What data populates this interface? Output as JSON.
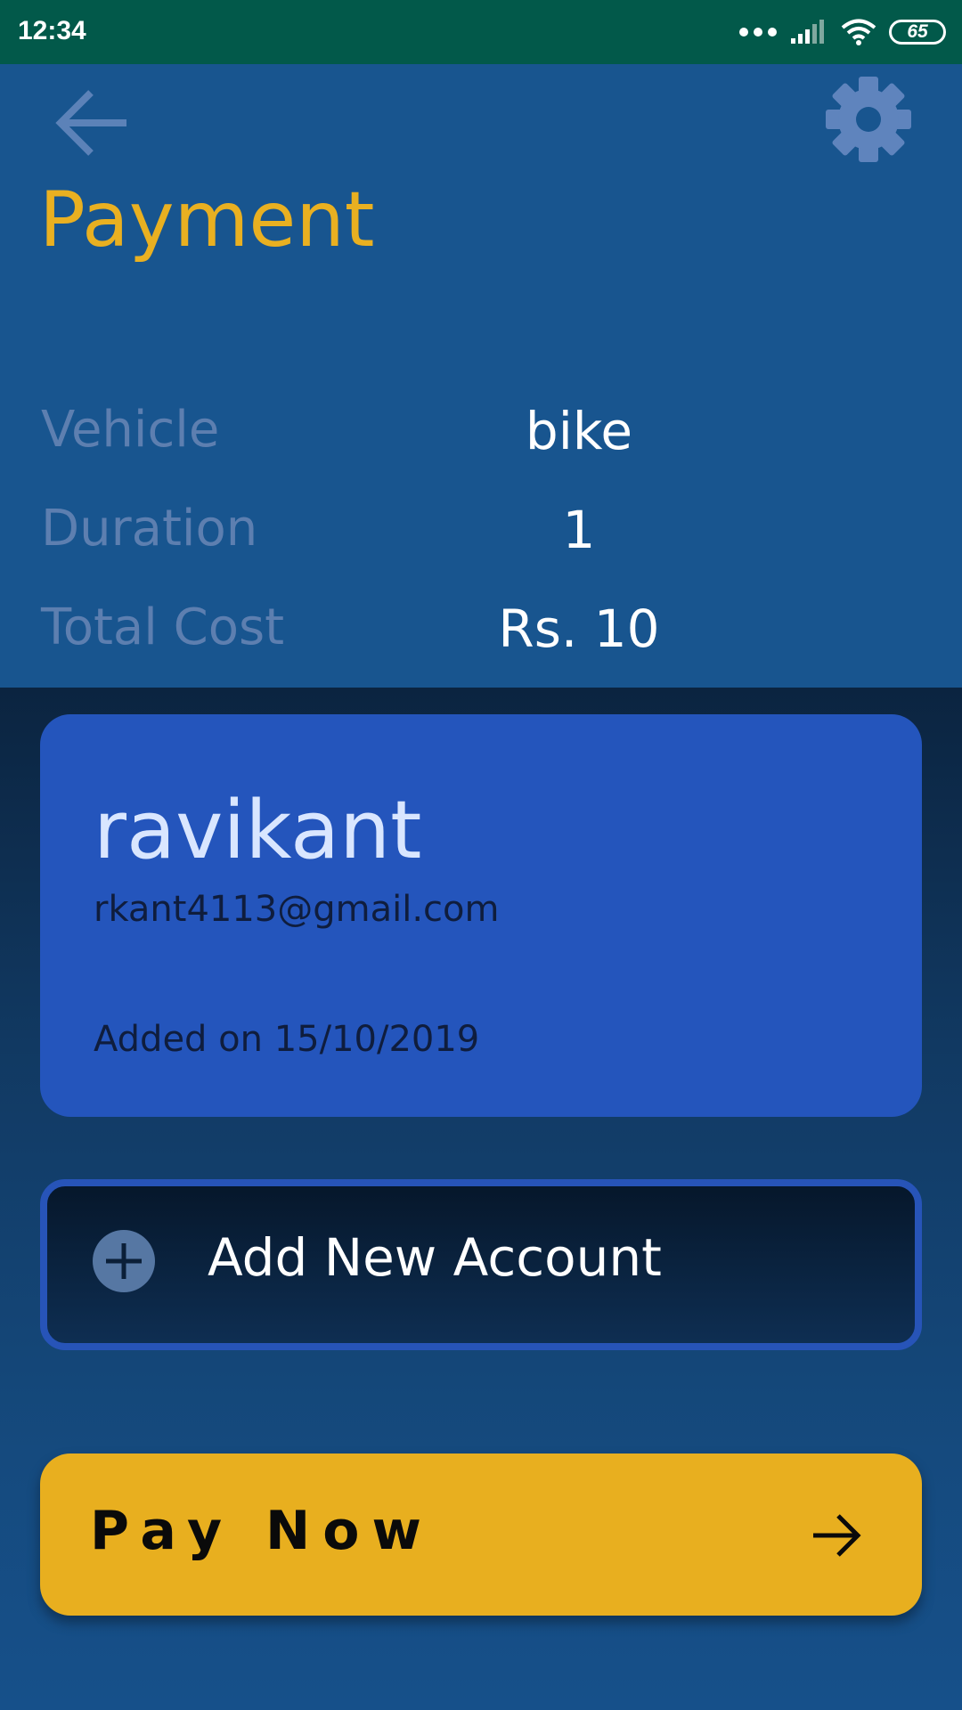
{
  "status_bar": {
    "time": "12:34",
    "battery": "65",
    "icons": [
      "more-dots-icon",
      "signal-icon",
      "wifi-icon",
      "battery-icon"
    ]
  },
  "header": {
    "back_icon": "arrow-left-icon",
    "settings_icon": "gear-icon",
    "title": "Payment"
  },
  "details": {
    "vehicle": {
      "label": "Vehicle",
      "value": "bike"
    },
    "duration": {
      "label": "Duration",
      "value": "1"
    },
    "total_cost": {
      "label": "Total Cost",
      "value": "Rs. 10"
    }
  },
  "account_card": {
    "name": "ravikant",
    "email": "rkant4113@gmail.com",
    "added": "Added on 15/10/2019"
  },
  "add_account": {
    "icon": "plus-circle-icon",
    "label": "Add New Account"
  },
  "pay_button": {
    "label": "Pay Now",
    "icon": "arrow-right-icon"
  },
  "colors": {
    "status_bar": "#02594a",
    "header_bg": "#18558f",
    "title": "#e9b021",
    "card": "#2455bc",
    "pay_button": "#e8af1f",
    "label_muted": "#5d7fb0"
  }
}
